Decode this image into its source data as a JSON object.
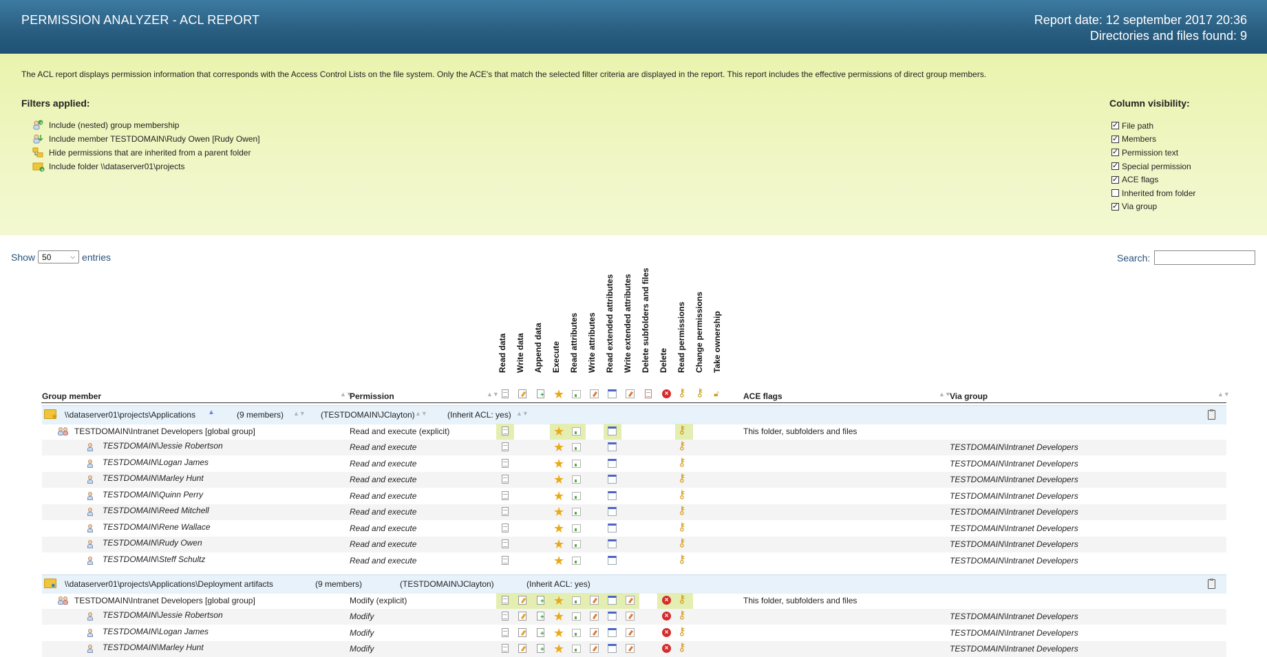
{
  "header": {
    "title": "PERMISSION ANALYZER - ACL REPORT",
    "report_date": "Report date: 12 september 2017 20:36",
    "found": "Directories and files found: 9"
  },
  "banner": {
    "description": "The ACL report displays permission information that corresponds with the Access Control Lists on the file system. Only the ACE's that match the selected filter criteria are displayed in the report. This report includes the effective permissions of direct group members.",
    "filters_title": "Filters applied:",
    "filters": [
      {
        "icon": "group-membership-icon",
        "label": "Include (nested) group membership"
      },
      {
        "icon": "member-icon",
        "label": "Include member TESTDOMAIN\\Rudy Owen [Rudy Owen]"
      },
      {
        "icon": "inherited-icon",
        "label": "Hide permissions that are inherited from a parent folder"
      },
      {
        "icon": "folder-add-icon",
        "label": "Include folder \\\\dataserver01\\projects"
      }
    ],
    "columns_title": "Column visibility:",
    "columns": [
      {
        "label": "File path",
        "checked": true
      },
      {
        "label": "Members",
        "checked": true
      },
      {
        "label": "Permission text",
        "checked": true
      },
      {
        "label": "Special permission",
        "checked": true
      },
      {
        "label": "ACE flags",
        "checked": true
      },
      {
        "label": "Inherited from folder",
        "checked": false
      },
      {
        "label": "Via group",
        "checked": true
      }
    ]
  },
  "controls": {
    "show_label": "Show",
    "page_size": "50",
    "entries_label": "entries",
    "search_label": "Search:",
    "search_value": ""
  },
  "table": {
    "col_group_member": "Group member",
    "col_permission": "Permission",
    "col_ace_flags": "ACE flags",
    "col_via_group": "Via group",
    "special_perms": [
      "Read data",
      "Write data",
      "Append data",
      "Execute",
      "Read attributes",
      "Write attributes",
      "Read extended attributes",
      "Write extended attributes",
      "Delete subfolders and files",
      "Delete",
      "Read permissions",
      "Change permissions",
      "Take ownership"
    ],
    "groups": [
      {
        "path": "\\\\dataserver01\\projects\\Applications",
        "members": "(9 members)",
        "owner": "(TESTDOMAIN\\JClayton)",
        "inherit": "(Inherit ACL: yes)",
        "group_row": {
          "name": "TESTDOMAIN\\Intranet Developers [global group]",
          "permission": "Read and execute (explicit)",
          "ace_flags": "This folder, subfolders and files"
        },
        "members_rows": [
          {
            "name": "TESTDOMAIN\\Jessie Robertson",
            "permission": "Read and execute",
            "via": "TESTDOMAIN\\Intranet Developers"
          },
          {
            "name": "TESTDOMAIN\\Logan James",
            "permission": "Read and execute",
            "via": "TESTDOMAIN\\Intranet Developers"
          },
          {
            "name": "TESTDOMAIN\\Marley Hunt",
            "permission": "Read and execute",
            "via": "TESTDOMAIN\\Intranet Developers"
          },
          {
            "name": "TESTDOMAIN\\Quinn Perry",
            "permission": "Read and execute",
            "via": "TESTDOMAIN\\Intranet Developers"
          },
          {
            "name": "TESTDOMAIN\\Reed Mitchell",
            "permission": "Read and execute",
            "via": "TESTDOMAIN\\Intranet Developers"
          },
          {
            "name": "TESTDOMAIN\\Rene Wallace",
            "permission": "Read and execute",
            "via": "TESTDOMAIN\\Intranet Developers"
          },
          {
            "name": "TESTDOMAIN\\Rudy Owen",
            "permission": "Read and execute",
            "via": "TESTDOMAIN\\Intranet Developers"
          },
          {
            "name": "TESTDOMAIN\\Steff Schultz",
            "permission": "Read and execute",
            "via": "TESTDOMAIN\\Intranet Developers"
          }
        ]
      },
      {
        "path": "\\\\dataserver01\\projects\\Applications\\Deployment artifacts",
        "members": "(9 members)",
        "owner": "(TESTDOMAIN\\JClayton)",
        "inherit": "(Inherit ACL: yes)",
        "group_row": {
          "name": "TESTDOMAIN\\Intranet Developers [global group]",
          "permission": "Modify (explicit)",
          "ace_flags": "This folder, subfolders and files"
        },
        "members_rows": [
          {
            "name": "TESTDOMAIN\\Jessie Robertson",
            "permission": "Modify",
            "via": "TESTDOMAIN\\Intranet Developers"
          },
          {
            "name": "TESTDOMAIN\\Logan James",
            "permission": "Modify",
            "via": "TESTDOMAIN\\Intranet Developers"
          },
          {
            "name": "TESTDOMAIN\\Marley Hunt",
            "permission": "Modify",
            "via": "TESTDOMAIN\\Intranet Developers"
          }
        ]
      }
    ]
  }
}
